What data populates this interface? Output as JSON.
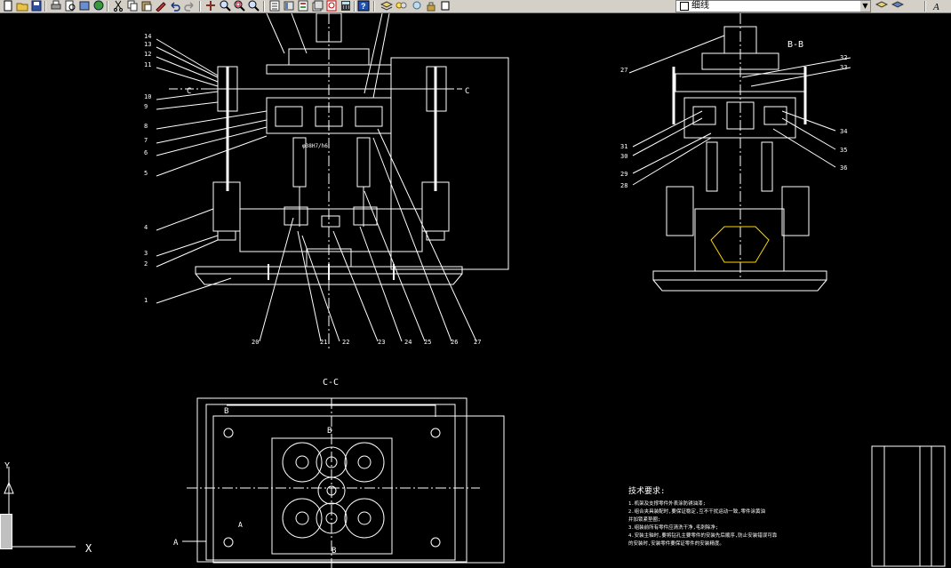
{
  "toolbar": {
    "lineweight_value": "细线",
    "icons": [
      "new-icon",
      "open-icon",
      "save-icon",
      "print-icon",
      "preview-icon",
      "publish-icon",
      "plot-icon",
      "cut-icon",
      "copy-icon",
      "paste-icon",
      "matchprop-icon",
      "undo-icon",
      "redo-icon",
      "pan-icon",
      "zoom-realtime-icon",
      "zoom-window-icon",
      "zoom-previous-icon",
      "properties-icon",
      "designcenter-icon",
      "toolpalette-icon",
      "sheetset-icon",
      "markup-icon",
      "calculator-icon",
      "help-icon",
      "layer-manager-icon",
      "layer-state-icon"
    ]
  },
  "drawing": {
    "section_cc": "C-C",
    "section_bb": "B-B",
    "section_mark_c": "C",
    "section_mark_b": "B",
    "section_mark_a": "A",
    "part_label_text": "φ38H7/h6",
    "left_callouts": [
      "14",
      "13",
      "12",
      "11",
      "10",
      "9",
      "8",
      "7",
      "6",
      "5",
      "4",
      "3",
      "2",
      "1"
    ],
    "bottom_callouts": [
      "20",
      "21",
      "22",
      "23",
      "24",
      "25",
      "26",
      "27"
    ],
    "right_callouts_left": [
      "27",
      "31",
      "30",
      "29",
      "28"
    ],
    "right_callouts_right": [
      "32",
      "33",
      "34",
      "35",
      "36"
    ],
    "tech_title": "技术要求:",
    "tech_lines": [
      "1.机架及支撑零件外表涂防锈油漆;",
      "2.组合夹具装配时,要保证稳定,互不干扰运动一致,零件涂黄油",
      "并加锁紧垫圈;",
      "3.组装前所有零件应清洗干净,毛刺除净;",
      "4.安装主轴时,要将钻孔主要零件的安装先后顺序,防止安装错误可靠",
      "的安装时,安装零件要保证零件的安装精度。"
    ],
    "ucs_x": "X",
    "ucs_y": "Y"
  }
}
